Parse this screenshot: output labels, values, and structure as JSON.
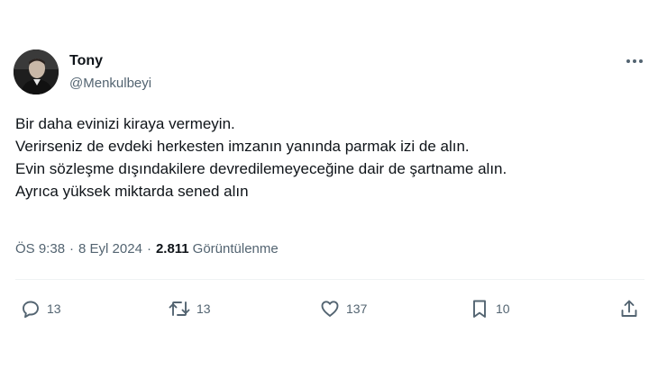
{
  "author": {
    "display_name": "Tony",
    "handle": "@Menkulbeyi",
    "avatar_icon": "person-portrait-avatar"
  },
  "more_icon": "ellipsis-icon",
  "tweet": {
    "lines": [
      "Bir daha evinizi kiraya vermeyin.",
      "Verirseniz de evdeki herkesten imzanın yanında parmak izi de alın.",
      "Evin sözleşme dışındakilere devredilemeyeceğine dair de şartname alın.",
      "Ayrıca yüksek miktarda sened alın"
    ]
  },
  "meta": {
    "time": "ÖS 9:38",
    "separator": "·",
    "date": "8 Eyl 2024",
    "views_count": "2.811",
    "views_label": "Görüntülenme"
  },
  "actions": {
    "reply": {
      "icon": "reply-icon",
      "count": "13"
    },
    "repost": {
      "icon": "repost-icon",
      "count": "13"
    },
    "like": {
      "icon": "heart-icon",
      "count": "137"
    },
    "bookmark": {
      "icon": "bookmark-icon",
      "count": "10"
    },
    "share": {
      "icon": "share-icon"
    }
  },
  "colors": {
    "text_primary": "#0f1419",
    "text_secondary": "#536471",
    "divider": "#eff3f4",
    "background": "#ffffff"
  }
}
